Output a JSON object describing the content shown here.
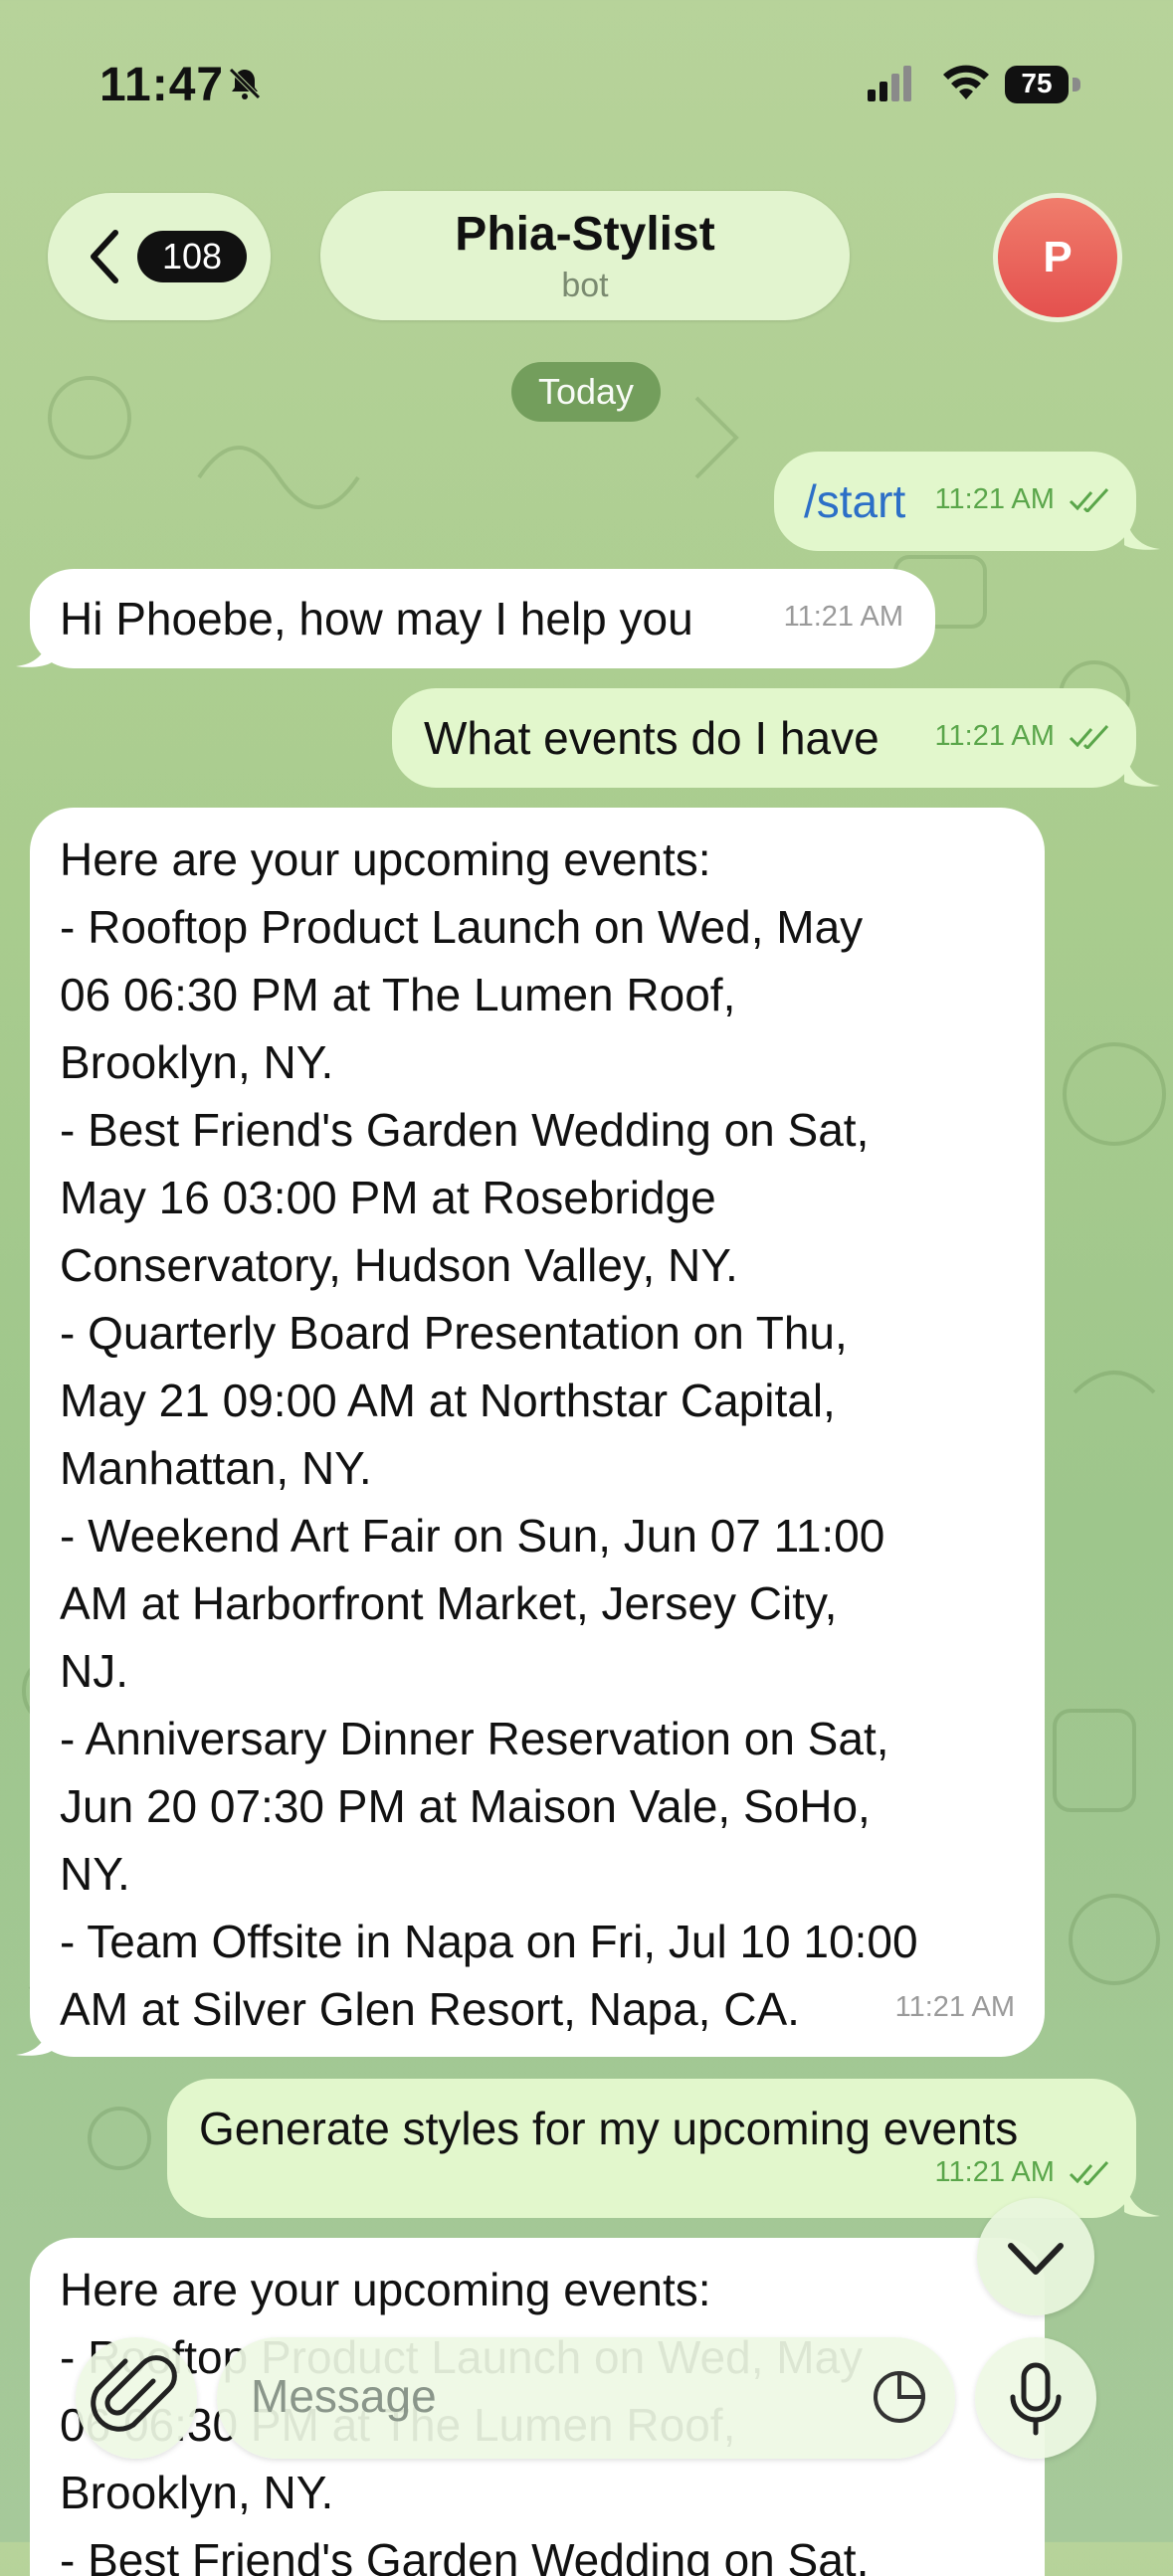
{
  "status_bar": {
    "time": "11:47",
    "battery": "75"
  },
  "header": {
    "back_count": "108",
    "title": "Phia-Stylist",
    "subtitle": "bot",
    "avatar_letter": "P"
  },
  "date_separator": "Today",
  "messages": [
    {
      "direction": "out",
      "text": "/start",
      "time": "11:21 AM"
    },
    {
      "direction": "in",
      "text": "Hi Phoebe, how may I help you",
      "time": "11:21 AM"
    },
    {
      "direction": "out",
      "text": "What events do I have",
      "time": "11:21 AM"
    },
    {
      "direction": "in",
      "text": "Here are your upcoming events:\n- Rooftop Product Launch on Wed, May\n06 06:30 PM at The Lumen Roof,\nBrooklyn, NY.\n- Best Friend's Garden Wedding on Sat,\nMay 16 03:00 PM at Rosebridge\nConservatory, Hudson Valley, NY.\n- Quarterly Board Presentation on Thu,\nMay 21 09:00 AM at Northstar Capital,\nManhattan, NY.\n- Weekend Art Fair on Sun, Jun 07 11:00\nAM at Harborfront Market, Jersey City,\nNJ.\n- Anniversary Dinner Reservation on Sat,\nJun 20 07:30 PM at Maison Vale, SoHo,\nNY.\n- Team Offsite in Napa on Fri, Jul 10 10:00\nAM at Silver Glen Resort, Napa, CA.",
      "time": "11:21 AM"
    },
    {
      "direction": "out",
      "text": "Generate styles for my upcoming events",
      "time": "11:21 AM"
    },
    {
      "direction": "in",
      "text": "Here are your upcoming events:\n- Rooftop Product Launch on Wed, May\n06 06:30 PM at The Lumen Roof,\nBrooklyn, NY.\n- Best Friend's Garden Wedding on Sat,",
      "time": ""
    }
  ],
  "input": {
    "placeholder": "Message"
  },
  "icons": {
    "back": "chevron-left-icon",
    "mute": "bell-slash-icon",
    "attach": "paperclip-icon",
    "sticker": "sticker-icon",
    "mic": "microphone-icon",
    "scroll": "chevron-down-icon"
  },
  "colors": {
    "outgoing_bubble": "#e2f7cc",
    "incoming_bubble": "#ffffff",
    "accent_green": "#5aa64a",
    "command_blue": "#2c6fc7"
  }
}
